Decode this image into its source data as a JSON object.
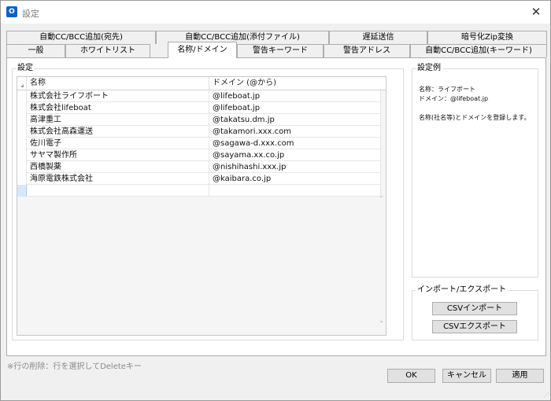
{
  "window": {
    "title": "設定",
    "app_icon_glyph": "O",
    "close_glyph": "✕"
  },
  "tabs": {
    "row1": [
      "自動CC/BCC追加(宛先)",
      "自動CC/BCC追加(添付ファイル)",
      "遅延送信",
      "暗号化Zip変換"
    ],
    "row2": [
      "一般",
      "ホワイトリスト",
      "名称/ドメイン",
      "警告キーワード",
      "警告アドレス",
      "自動CC/BCC追加(キーワード)"
    ],
    "active": "名称/ドメイン"
  },
  "settings_group": {
    "title": "設定",
    "columns": [
      "名称",
      "ドメイン (@から)"
    ],
    "rows": [
      [
        "株式会社ライフボート",
        "@lifeboat.jp"
      ],
      [
        "株式会社lifeboat",
        "@lifeboat.jp"
      ],
      [
        "高津重工",
        "@takatsu.dm.jp"
      ],
      [
        "株式会社高森運送",
        "@takamori.xxx.com"
      ],
      [
        "佐川電子",
        "@sagawa-d.xxx.com"
      ],
      [
        "サヤマ製作所",
        "@sayama.xx.co.jp"
      ],
      [
        "西橋製薬",
        "@nishihashi.xxx.jp"
      ],
      [
        "海原電鉄株式会社",
        "@kaibara.co.jp"
      ]
    ]
  },
  "example_group": {
    "title": "設定例",
    "line1": "名称：ライフボート",
    "line2": "ドメイン：@lifeboat.jp",
    "line3": "名称(社名等)とドメインを登録します。"
  },
  "import_export_group": {
    "title": "インポート/エクスポート",
    "csv_import": "CSVインポート",
    "csv_export": "CSVエクスポート"
  },
  "footer": {
    "note": "※行の削除：行を選択してDeleteキー",
    "ok": "OK",
    "cancel": "キャンセル",
    "apply": "適用"
  }
}
